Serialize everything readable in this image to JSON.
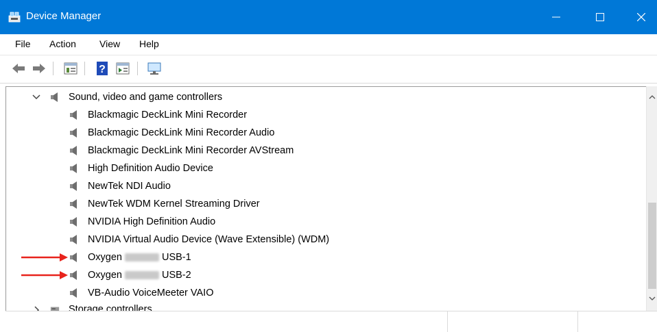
{
  "window": {
    "title": "Device Manager"
  },
  "menu": [
    "File",
    "Action",
    "View",
    "Help"
  ],
  "tree": {
    "category": "Sound, video and game controllers",
    "devices": [
      {
        "label": "Blackmagic DeckLink Mini Recorder"
      },
      {
        "label": "Blackmagic DeckLink Mini Recorder Audio"
      },
      {
        "label": "Blackmagic DeckLink Mini Recorder AVStream"
      },
      {
        "label": "High Definition Audio Device"
      },
      {
        "label": "NewTek NDI Audio"
      },
      {
        "label": "NewTek WDM Kernel Streaming Driver"
      },
      {
        "label": "NVIDIA High Definition Audio"
      },
      {
        "label": "NVIDIA Virtual Audio Device (Wave Extensible) (WDM)"
      },
      {
        "prefix": "Oxygen",
        "suffix": "USB-1",
        "highlighted": true
      },
      {
        "prefix": "Oxygen",
        "suffix": "USB-2",
        "highlighted": true
      },
      {
        "label": "VB-Audio VoiceMeeter VAIO"
      }
    ],
    "next_category": "Storage controllers"
  },
  "colors": {
    "titlebar": "#0078d7",
    "arrow": "#e8231c",
    "thumb": "#cdcdcd"
  },
  "icons": [
    "device-manager-icon",
    "back-arrow-icon",
    "forward-arrow-icon",
    "properties-icon",
    "help-icon",
    "update-driver-icon",
    "monitor-icon",
    "speaker-icon",
    "storage-icon",
    "chevron-down-icon",
    "chevron-right-icon"
  ]
}
